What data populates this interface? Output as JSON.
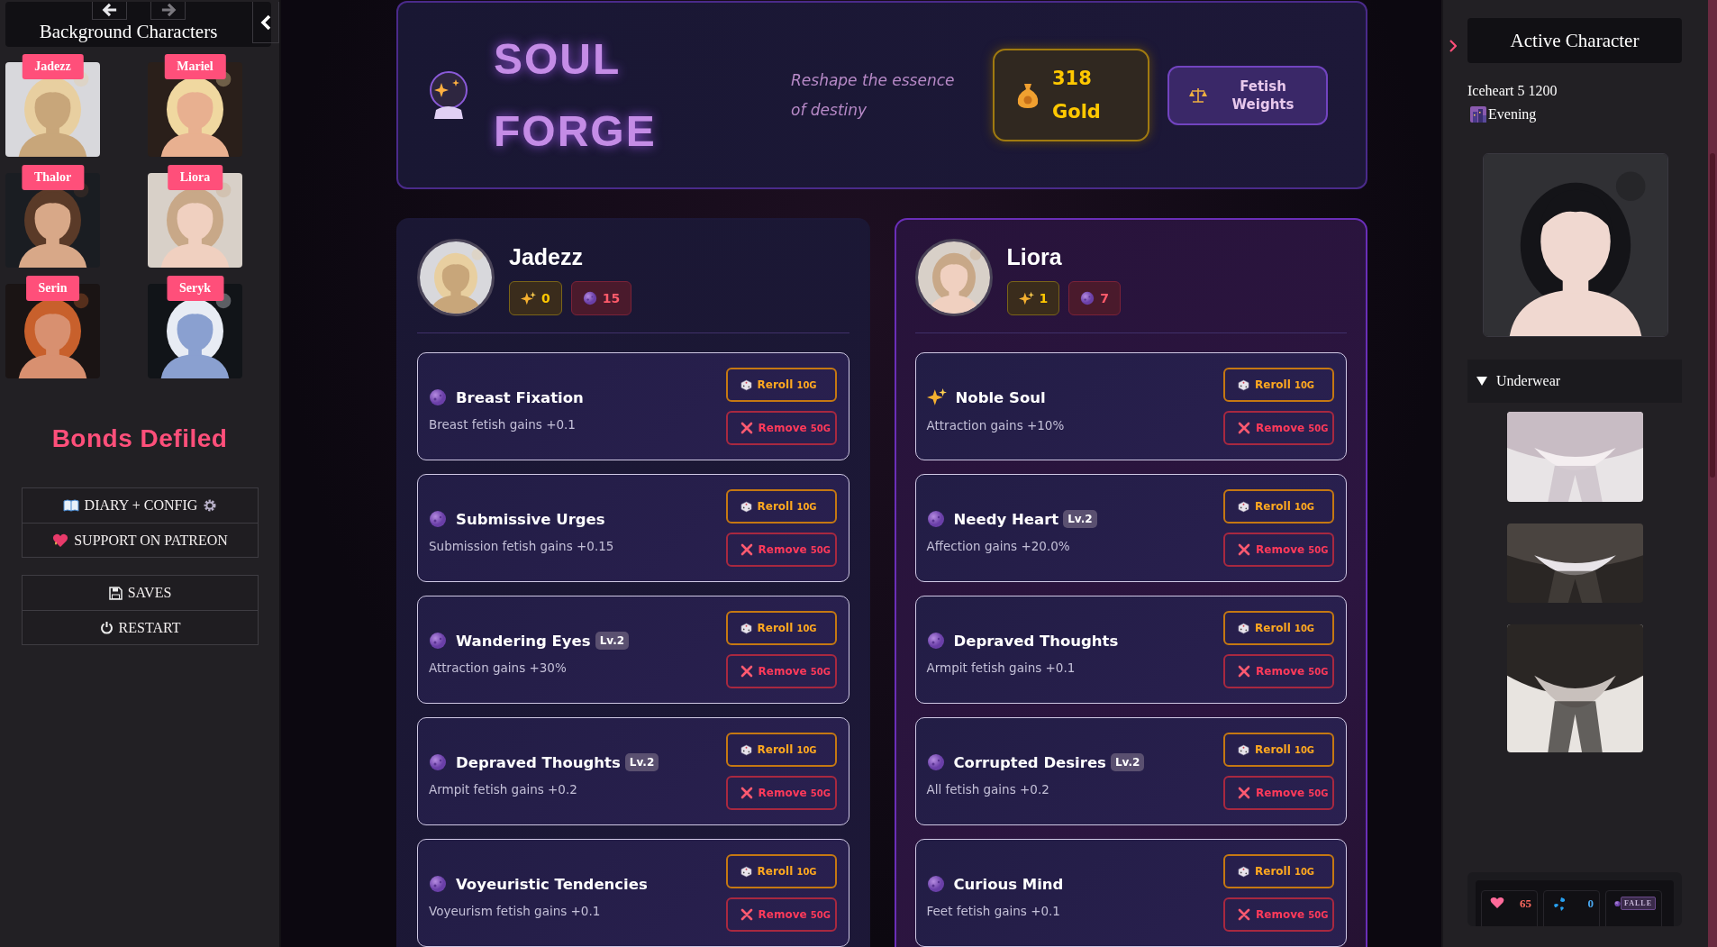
{
  "left_sidebar": {
    "title": "Background Characters",
    "characters": [
      {
        "name": "Jadezz"
      },
      {
        "name": "Mariel"
      },
      {
        "name": "Thalor"
      },
      {
        "name": "Liora"
      },
      {
        "name": "Serin"
      },
      {
        "name": "Seryk"
      }
    ],
    "game_title": "Bonds Defiled",
    "menu": [
      {
        "kind": "diary",
        "label": "DIARY + CONFIG"
      },
      {
        "kind": "patreon",
        "label": "SUPPORT ON PATREON"
      }
    ],
    "system_menu": [
      {
        "kind": "saves",
        "label": "SAVES"
      },
      {
        "kind": "restart",
        "label": "RESTART"
      }
    ]
  },
  "forge": {
    "title_lines": [
      "SOUL",
      "FORGE"
    ],
    "tagline": "Reshape the essence of destiny",
    "gold": {
      "amount": "318",
      "unit": "Gold"
    },
    "weights_button": "Fetish Weights"
  },
  "panels": [
    {
      "name": "Jadezz",
      "selected": false,
      "sparks": "0",
      "orbs": "15",
      "traits": [
        {
          "kind": "orb",
          "name": "Breast Fixation",
          "description": "Breast fetish gains +0.1",
          "reroll": {
            "label": "Reroll",
            "cost": "10G"
          },
          "remove": {
            "label": "Remove",
            "cost": "50G"
          }
        },
        {
          "kind": "orb",
          "name": "Submissive Urges",
          "description": "Submission fetish gains +0.15",
          "reroll": {
            "label": "Reroll",
            "cost": "10G"
          },
          "remove": {
            "label": "Remove",
            "cost": "50G"
          }
        },
        {
          "kind": "orb",
          "name": "Wandering Eyes",
          "level": "Lv.2",
          "description": "Attraction gains +30%",
          "reroll": {
            "label": "Reroll",
            "cost": "10G"
          },
          "remove": {
            "label": "Remove",
            "cost": "50G"
          }
        },
        {
          "kind": "orb",
          "name": "Depraved Thoughts",
          "level": "Lv.2",
          "description": "Armpit fetish gains +0.2",
          "reroll": {
            "label": "Reroll",
            "cost": "10G"
          },
          "remove": {
            "label": "Remove",
            "cost": "50G"
          }
        },
        {
          "kind": "orb",
          "name": "Voyeuristic Tendencies",
          "description": "Voyeurism fetish gains +0.1",
          "reroll": {
            "label": "Reroll",
            "cost": "10G"
          },
          "remove": {
            "label": "Remove",
            "cost": "50G"
          }
        }
      ]
    },
    {
      "name": "Liora",
      "selected": true,
      "sparks": "1",
      "orbs": "7",
      "traits": [
        {
          "kind": "spark",
          "name": "Noble Soul",
          "description": "Attraction gains +10%",
          "reroll": {
            "label": "Reroll",
            "cost": "10G"
          },
          "remove": {
            "label": "Remove",
            "cost": "50G"
          }
        },
        {
          "kind": "orb",
          "name": "Needy Heart",
          "level": "Lv.2",
          "description": "Affection gains +20.0%",
          "reroll": {
            "label": "Reroll",
            "cost": "10G"
          },
          "remove": {
            "label": "Remove",
            "cost": "50G"
          }
        },
        {
          "kind": "orb",
          "name": "Depraved Thoughts",
          "description": "Armpit fetish gains +0.1",
          "reroll": {
            "label": "Reroll",
            "cost": "10G"
          },
          "remove": {
            "label": "Remove",
            "cost": "50G"
          }
        },
        {
          "kind": "orb",
          "name": "Corrupted Desires",
          "level": "Lv.2",
          "description": "All fetish gains +0.2",
          "reroll": {
            "label": "Reroll",
            "cost": "10G"
          },
          "remove": {
            "label": "Remove",
            "cost": "50G"
          }
        },
        {
          "kind": "orb",
          "name": "Curious Mind",
          "description": "Feet fetish gains +0.1",
          "reroll": {
            "label": "Reroll",
            "cost": "10G"
          },
          "remove": {
            "label": "Remove",
            "cost": "50G"
          }
        }
      ]
    }
  ],
  "active_character": {
    "title": "Active Character",
    "info": "Iceheart 5 1200",
    "time": "Evening",
    "section": {
      "title": "Underwear",
      "expanded": true
    },
    "stats": [
      {
        "kind": "heart",
        "value": "65"
      },
      {
        "kind": "drops",
        "value": "0"
      },
      {
        "kind": "orb",
        "value": "FALLE"
      }
    ]
  }
}
